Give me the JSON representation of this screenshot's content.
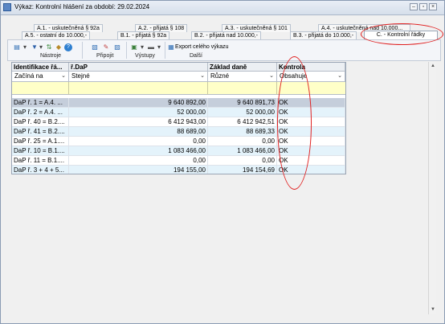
{
  "window": {
    "title": "Výkaz: Kontrolní hlášení za období: 29.02.2024"
  },
  "tabs_row1": [
    "A.1. - uskutečněná § 92a",
    "A.2. - přijatá § 108",
    "A.3. - uskutečněná § 101",
    "A.4. - uskutečněná nad 10.000..."
  ],
  "tabs_row2": [
    "A.5. - ostatní do 10.000,-",
    "B.1. - přijatá § 92a",
    "B.2. - přijatá nad 10.000,-",
    "B.3. - přijatá do 10.000,-",
    "C. - Kontrolní řádky"
  ],
  "ribbon": {
    "groups": [
      "Nástroje",
      "Připojit",
      "Výstupy",
      "Další"
    ],
    "export_label": "Export celého výkazu"
  },
  "grid": {
    "columns": [
      "Identifikace řá...",
      "ř.DaP",
      "Základ daně",
      "Kontrola"
    ],
    "filters": [
      "Začíná na",
      "Stejné",
      "Různé",
      "Obsahuje"
    ],
    "rows": [
      {
        "id": "DaP ř. 1 = A.4. ...",
        "dap": "9 640 892,00",
        "zaklad": "9 640 891,73",
        "kontrola": "OK"
      },
      {
        "id": "DaP ř. 2 = A.4. ...",
        "dap": "52 000,00",
        "zaklad": "52 000,00",
        "kontrola": "OK"
      },
      {
        "id": "DaP ř. 40 = B.2....",
        "dap": "6 412 943,00",
        "zaklad": "6 412 942,51",
        "kontrola": "OK"
      },
      {
        "id": "DaP ř. 41 = B.2....",
        "dap": "88 689,00",
        "zaklad": "88 689,33",
        "kontrola": "OK"
      },
      {
        "id": "DaP ř. 25 = A.1....",
        "dap": "0,00",
        "zaklad": "0,00",
        "kontrola": "OK"
      },
      {
        "id": "DaP ř. 10 = B.1....",
        "dap": "1 083 466,00",
        "zaklad": "1 083 466,00",
        "kontrola": "OK"
      },
      {
        "id": "DaP ř. 11 = B.1....",
        "dap": "0,00",
        "zaklad": "0,00",
        "kontrola": "OK"
      },
      {
        "id": "DaP ř. 3 + 4 + 5...",
        "dap": "194 155,00",
        "zaklad": "194 154,69",
        "kontrola": "OK"
      }
    ]
  },
  "colors": {
    "selected_row": "#c5cedb",
    "alt_row": "#e4f3fb",
    "filter_row": "#ffffc8",
    "annotation": "#e02020"
  }
}
